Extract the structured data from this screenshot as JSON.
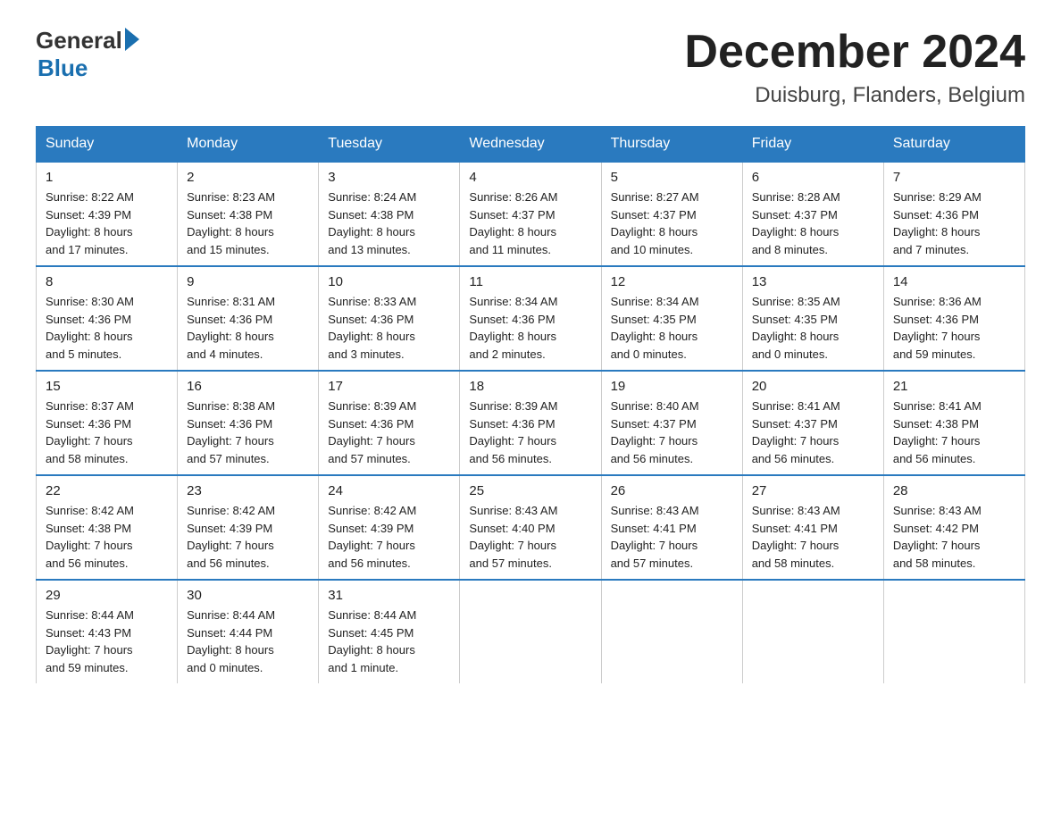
{
  "header": {
    "logo_general": "General",
    "logo_blue": "Blue",
    "month_title": "December 2024",
    "location": "Duisburg, Flanders, Belgium"
  },
  "days_of_week": [
    "Sunday",
    "Monday",
    "Tuesday",
    "Wednesday",
    "Thursday",
    "Friday",
    "Saturday"
  ],
  "weeks": [
    [
      {
        "day": "1",
        "sunrise": "Sunrise: 8:22 AM",
        "sunset": "Sunset: 4:39 PM",
        "daylight": "Daylight: 8 hours",
        "daylight2": "and 17 minutes."
      },
      {
        "day": "2",
        "sunrise": "Sunrise: 8:23 AM",
        "sunset": "Sunset: 4:38 PM",
        "daylight": "Daylight: 8 hours",
        "daylight2": "and 15 minutes."
      },
      {
        "day": "3",
        "sunrise": "Sunrise: 8:24 AM",
        "sunset": "Sunset: 4:38 PM",
        "daylight": "Daylight: 8 hours",
        "daylight2": "and 13 minutes."
      },
      {
        "day": "4",
        "sunrise": "Sunrise: 8:26 AM",
        "sunset": "Sunset: 4:37 PM",
        "daylight": "Daylight: 8 hours",
        "daylight2": "and 11 minutes."
      },
      {
        "day": "5",
        "sunrise": "Sunrise: 8:27 AM",
        "sunset": "Sunset: 4:37 PM",
        "daylight": "Daylight: 8 hours",
        "daylight2": "and 10 minutes."
      },
      {
        "day": "6",
        "sunrise": "Sunrise: 8:28 AM",
        "sunset": "Sunset: 4:37 PM",
        "daylight": "Daylight: 8 hours",
        "daylight2": "and 8 minutes."
      },
      {
        "day": "7",
        "sunrise": "Sunrise: 8:29 AM",
        "sunset": "Sunset: 4:36 PM",
        "daylight": "Daylight: 8 hours",
        "daylight2": "and 7 minutes."
      }
    ],
    [
      {
        "day": "8",
        "sunrise": "Sunrise: 8:30 AM",
        "sunset": "Sunset: 4:36 PM",
        "daylight": "Daylight: 8 hours",
        "daylight2": "and 5 minutes."
      },
      {
        "day": "9",
        "sunrise": "Sunrise: 8:31 AM",
        "sunset": "Sunset: 4:36 PM",
        "daylight": "Daylight: 8 hours",
        "daylight2": "and 4 minutes."
      },
      {
        "day": "10",
        "sunrise": "Sunrise: 8:33 AM",
        "sunset": "Sunset: 4:36 PM",
        "daylight": "Daylight: 8 hours",
        "daylight2": "and 3 minutes."
      },
      {
        "day": "11",
        "sunrise": "Sunrise: 8:34 AM",
        "sunset": "Sunset: 4:36 PM",
        "daylight": "Daylight: 8 hours",
        "daylight2": "and 2 minutes."
      },
      {
        "day": "12",
        "sunrise": "Sunrise: 8:34 AM",
        "sunset": "Sunset: 4:35 PM",
        "daylight": "Daylight: 8 hours",
        "daylight2": "and 0 minutes."
      },
      {
        "day": "13",
        "sunrise": "Sunrise: 8:35 AM",
        "sunset": "Sunset: 4:35 PM",
        "daylight": "Daylight: 8 hours",
        "daylight2": "and 0 minutes."
      },
      {
        "day": "14",
        "sunrise": "Sunrise: 8:36 AM",
        "sunset": "Sunset: 4:36 PM",
        "daylight": "Daylight: 7 hours",
        "daylight2": "and 59 minutes."
      }
    ],
    [
      {
        "day": "15",
        "sunrise": "Sunrise: 8:37 AM",
        "sunset": "Sunset: 4:36 PM",
        "daylight": "Daylight: 7 hours",
        "daylight2": "and 58 minutes."
      },
      {
        "day": "16",
        "sunrise": "Sunrise: 8:38 AM",
        "sunset": "Sunset: 4:36 PM",
        "daylight": "Daylight: 7 hours",
        "daylight2": "and 57 minutes."
      },
      {
        "day": "17",
        "sunrise": "Sunrise: 8:39 AM",
        "sunset": "Sunset: 4:36 PM",
        "daylight": "Daylight: 7 hours",
        "daylight2": "and 57 minutes."
      },
      {
        "day": "18",
        "sunrise": "Sunrise: 8:39 AM",
        "sunset": "Sunset: 4:36 PM",
        "daylight": "Daylight: 7 hours",
        "daylight2": "and 56 minutes."
      },
      {
        "day": "19",
        "sunrise": "Sunrise: 8:40 AM",
        "sunset": "Sunset: 4:37 PM",
        "daylight": "Daylight: 7 hours",
        "daylight2": "and 56 minutes."
      },
      {
        "day": "20",
        "sunrise": "Sunrise: 8:41 AM",
        "sunset": "Sunset: 4:37 PM",
        "daylight": "Daylight: 7 hours",
        "daylight2": "and 56 minutes."
      },
      {
        "day": "21",
        "sunrise": "Sunrise: 8:41 AM",
        "sunset": "Sunset: 4:38 PM",
        "daylight": "Daylight: 7 hours",
        "daylight2": "and 56 minutes."
      }
    ],
    [
      {
        "day": "22",
        "sunrise": "Sunrise: 8:42 AM",
        "sunset": "Sunset: 4:38 PM",
        "daylight": "Daylight: 7 hours",
        "daylight2": "and 56 minutes."
      },
      {
        "day": "23",
        "sunrise": "Sunrise: 8:42 AM",
        "sunset": "Sunset: 4:39 PM",
        "daylight": "Daylight: 7 hours",
        "daylight2": "and 56 minutes."
      },
      {
        "day": "24",
        "sunrise": "Sunrise: 8:42 AM",
        "sunset": "Sunset: 4:39 PM",
        "daylight": "Daylight: 7 hours",
        "daylight2": "and 56 minutes."
      },
      {
        "day": "25",
        "sunrise": "Sunrise: 8:43 AM",
        "sunset": "Sunset: 4:40 PM",
        "daylight": "Daylight: 7 hours",
        "daylight2": "and 57 minutes."
      },
      {
        "day": "26",
        "sunrise": "Sunrise: 8:43 AM",
        "sunset": "Sunset: 4:41 PM",
        "daylight": "Daylight: 7 hours",
        "daylight2": "and 57 minutes."
      },
      {
        "day": "27",
        "sunrise": "Sunrise: 8:43 AM",
        "sunset": "Sunset: 4:41 PM",
        "daylight": "Daylight: 7 hours",
        "daylight2": "and 58 minutes."
      },
      {
        "day": "28",
        "sunrise": "Sunrise: 8:43 AM",
        "sunset": "Sunset: 4:42 PM",
        "daylight": "Daylight: 7 hours",
        "daylight2": "and 58 minutes."
      }
    ],
    [
      {
        "day": "29",
        "sunrise": "Sunrise: 8:44 AM",
        "sunset": "Sunset: 4:43 PM",
        "daylight": "Daylight: 7 hours",
        "daylight2": "and 59 minutes."
      },
      {
        "day": "30",
        "sunrise": "Sunrise: 8:44 AM",
        "sunset": "Sunset: 4:44 PM",
        "daylight": "Daylight: 8 hours",
        "daylight2": "and 0 minutes."
      },
      {
        "day": "31",
        "sunrise": "Sunrise: 8:44 AM",
        "sunset": "Sunset: 4:45 PM",
        "daylight": "Daylight: 8 hours",
        "daylight2": "and 1 minute."
      },
      {
        "day": "",
        "sunrise": "",
        "sunset": "",
        "daylight": "",
        "daylight2": ""
      },
      {
        "day": "",
        "sunrise": "",
        "sunset": "",
        "daylight": "",
        "daylight2": ""
      },
      {
        "day": "",
        "sunrise": "",
        "sunset": "",
        "daylight": "",
        "daylight2": ""
      },
      {
        "day": "",
        "sunrise": "",
        "sunset": "",
        "daylight": "",
        "daylight2": ""
      }
    ]
  ]
}
